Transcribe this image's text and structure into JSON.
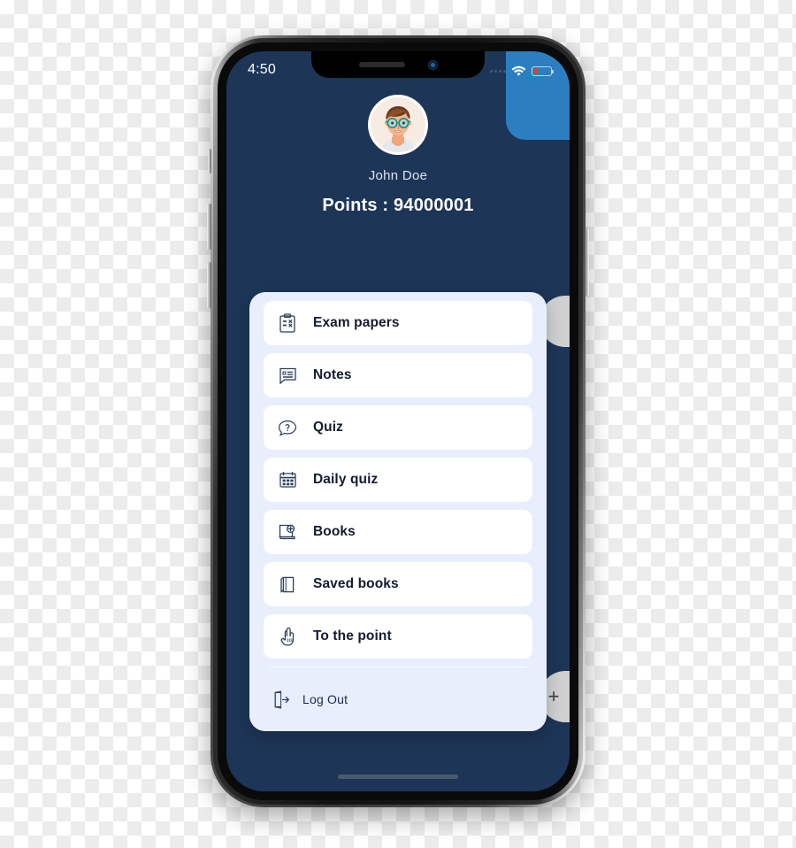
{
  "device": {
    "name": "smartphone-mockup",
    "frame_color": "#3a3a3a"
  },
  "status_bar": {
    "time": "4:50",
    "signal_icon": "signal-dots-icon",
    "wifi_icon": "wifi-icon",
    "battery_icon": "battery-low-icon",
    "battery_level_percent": 22,
    "battery_color": "#e8392b"
  },
  "screen": {
    "background_color": "#1d3557",
    "accent_panel_color": "#2b7fc0"
  },
  "profile": {
    "avatar_icon": "user-avatar",
    "name": "John Doe",
    "points_label": "Points : 94000001"
  },
  "drawer": {
    "background_color": "#e8eefb",
    "items": [
      {
        "icon": "clipboard-checklist-icon",
        "label": "Exam papers"
      },
      {
        "icon": "notes-icon",
        "label": "Notes"
      },
      {
        "icon": "question-bubble-icon",
        "label": "Quiz"
      },
      {
        "icon": "calendar-icon",
        "label": "Daily quiz"
      },
      {
        "icon": "book-add-icon",
        "label": "Books"
      },
      {
        "icon": "saved-books-icon",
        "label": "Saved books"
      },
      {
        "icon": "pointing-hand-icon",
        "label": "To the point"
      },
      {
        "icon": "partial-icon",
        "label": ""
      }
    ],
    "logout": {
      "icon": "logout-icon",
      "label": "Log Out"
    }
  },
  "floating_buttons": [
    {
      "name": "side-handle-top",
      "icon": "",
      "color": "#d0d0d0"
    },
    {
      "name": "side-handle-bottom",
      "icon": "plus-icon",
      "color": "#d0d0d0"
    }
  ]
}
